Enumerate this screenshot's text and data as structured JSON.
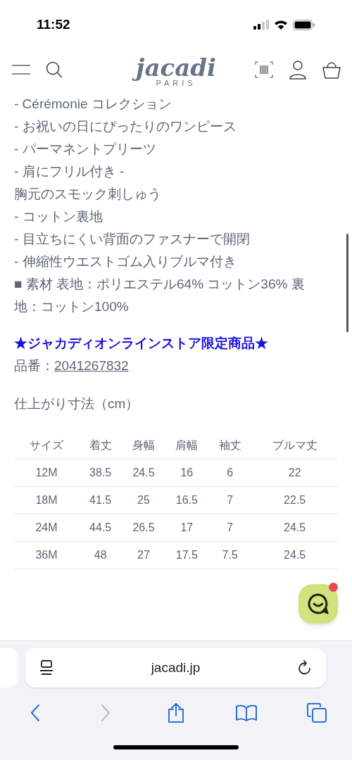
{
  "status_bar": {
    "time": "11:52"
  },
  "header": {
    "logo": "jacadi",
    "logo_sub": "PARIS"
  },
  "description": [
    "- Cérémonie コレクション",
    "- お祝いの日にぴったりのワンピース",
    "- パーマネントプリーツ",
    "- 肩にフリル付き -",
    "胸元のスモック刺しゅう",
    "- コットン裏地",
    "- 目立ちにくい背面のファスナーで開閉",
    "- 伸縮性ウエストゴム入りブルマ付き",
    "■ 素材 表地：ポリエステル64% コットン36% 裏地：コットン100%"
  ],
  "promo": "★ジャカディオンラインストア限定商品★",
  "product_number": {
    "label": "品番：",
    "value": "2041267832"
  },
  "size_title": "仕上がり寸法（cm）",
  "size_table": {
    "columns": [
      "サイズ",
      "着丈",
      "身幅",
      "肩幅",
      "袖丈",
      "ブルマ丈"
    ],
    "rows": [
      [
        "12M",
        "38.5",
        "24.5",
        "16",
        "6",
        "22"
      ],
      [
        "18M",
        "41.5",
        "25",
        "16.5",
        "7",
        "22.5"
      ],
      [
        "24M",
        "44.5",
        "26.5",
        "17",
        "7",
        "24.5"
      ],
      [
        "36M",
        "48",
        "27",
        "17.5",
        "7.5",
        "24.5"
      ]
    ]
  },
  "chat": {
    "unread": true
  },
  "browser": {
    "url": "jacadi.jp",
    "toolbar": [
      {
        "kind": "back",
        "disabled": false
      },
      {
        "kind": "forward",
        "disabled": true
      },
      {
        "kind": "share",
        "disabled": false
      },
      {
        "kind": "bookmarks",
        "disabled": false
      },
      {
        "kind": "tabs",
        "disabled": false
      }
    ]
  }
}
